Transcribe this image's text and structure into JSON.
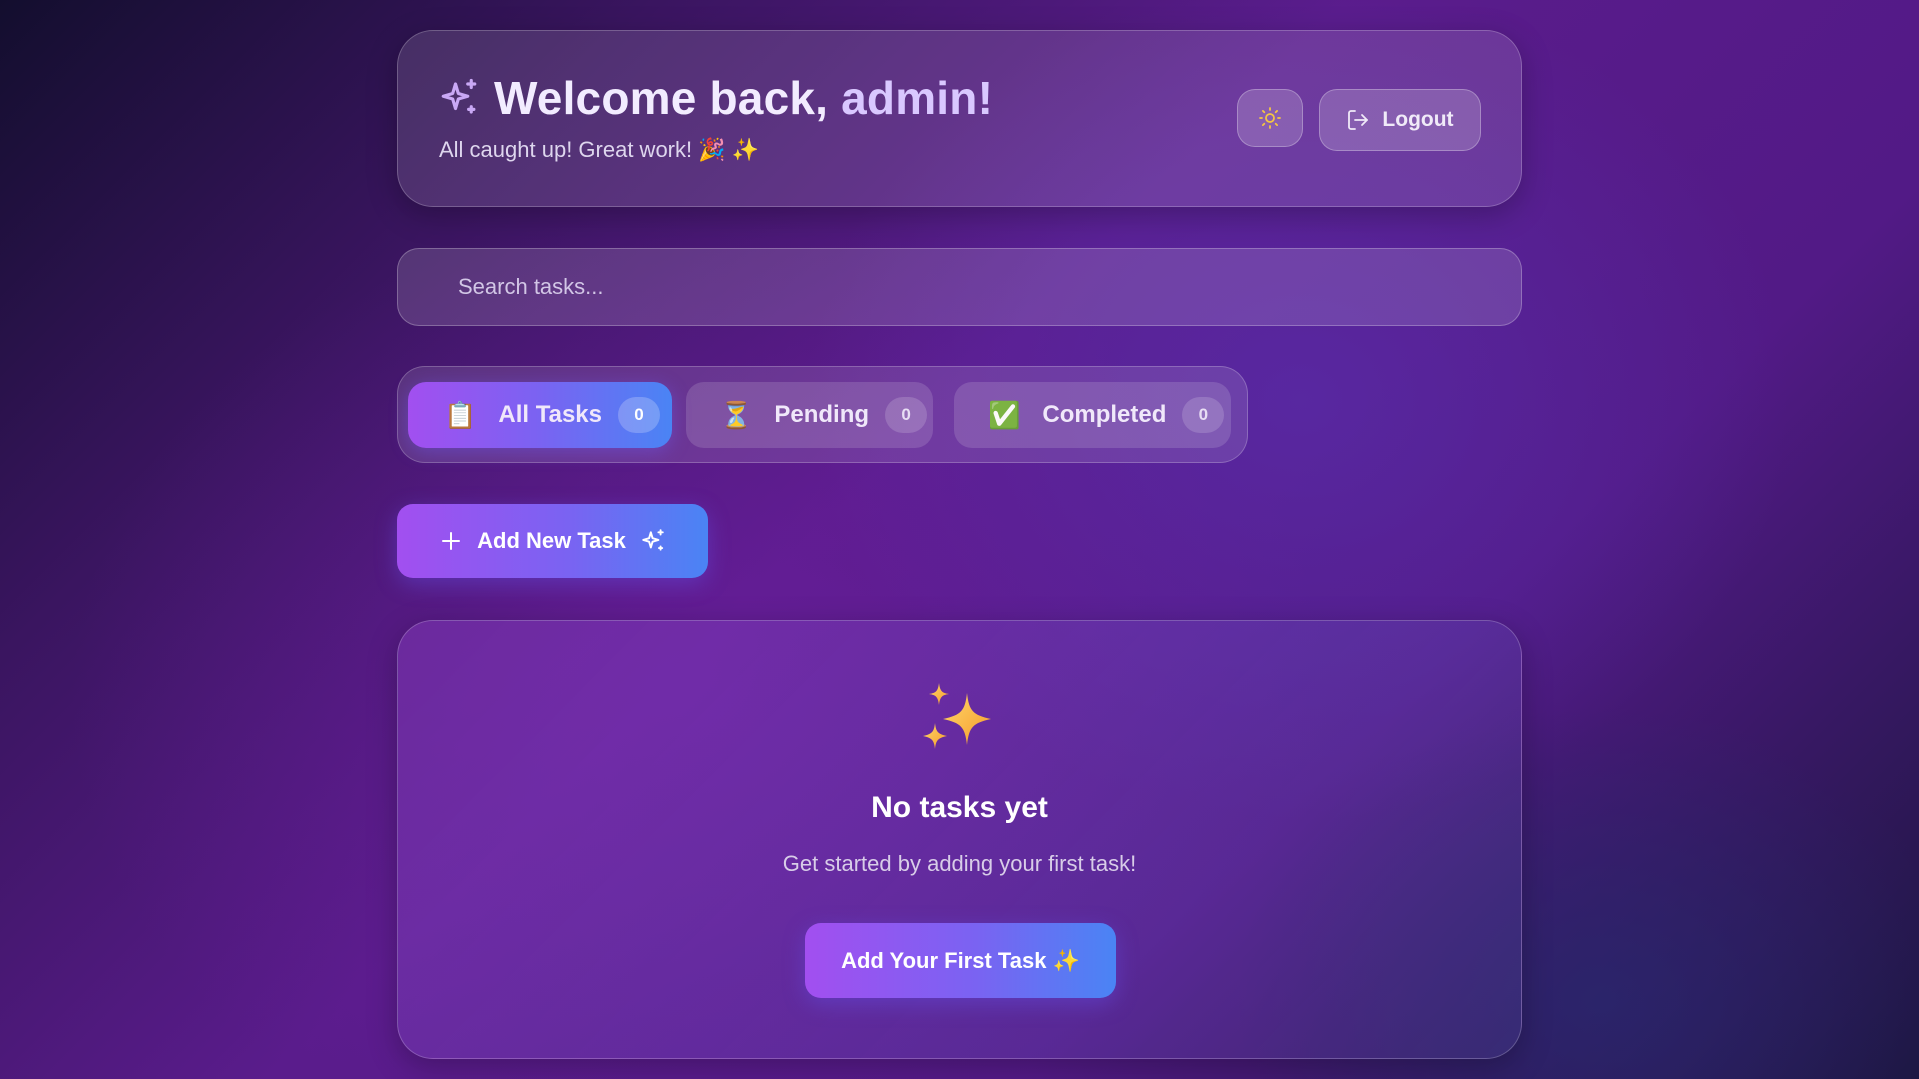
{
  "header": {
    "greeting": "Welcome back,",
    "username": "admin!",
    "subtitle": "All caught up! Great work! 🎉 ✨",
    "theme_icon": "sun-icon",
    "logout_label": "Logout",
    "logout_icon": "logout-icon"
  },
  "search": {
    "placeholder": "Search tasks...",
    "value": ""
  },
  "tabs": [
    {
      "label": "All Tasks",
      "icon": "📋",
      "count": "0",
      "active": true
    },
    {
      "label": "Pending",
      "icon": "⏳",
      "count": "0",
      "active": false
    },
    {
      "label": "Completed",
      "icon": "✅",
      "count": "0",
      "active": false
    }
  ],
  "add_button": {
    "label": "Add New Task",
    "icon_left": "plus-icon",
    "icon_right": "sparkles-icon"
  },
  "empty_state": {
    "icon": "sparkles-emoji",
    "title": "No tasks yet",
    "message": "Get started by adding your first task!",
    "button_label": "Add Your First Task ✨"
  },
  "colors": {
    "accent_start": "#a24ff0",
    "accent_end": "#4a84f4",
    "sun": "#f5c642",
    "sparkle_header": "#c9a8f5"
  }
}
